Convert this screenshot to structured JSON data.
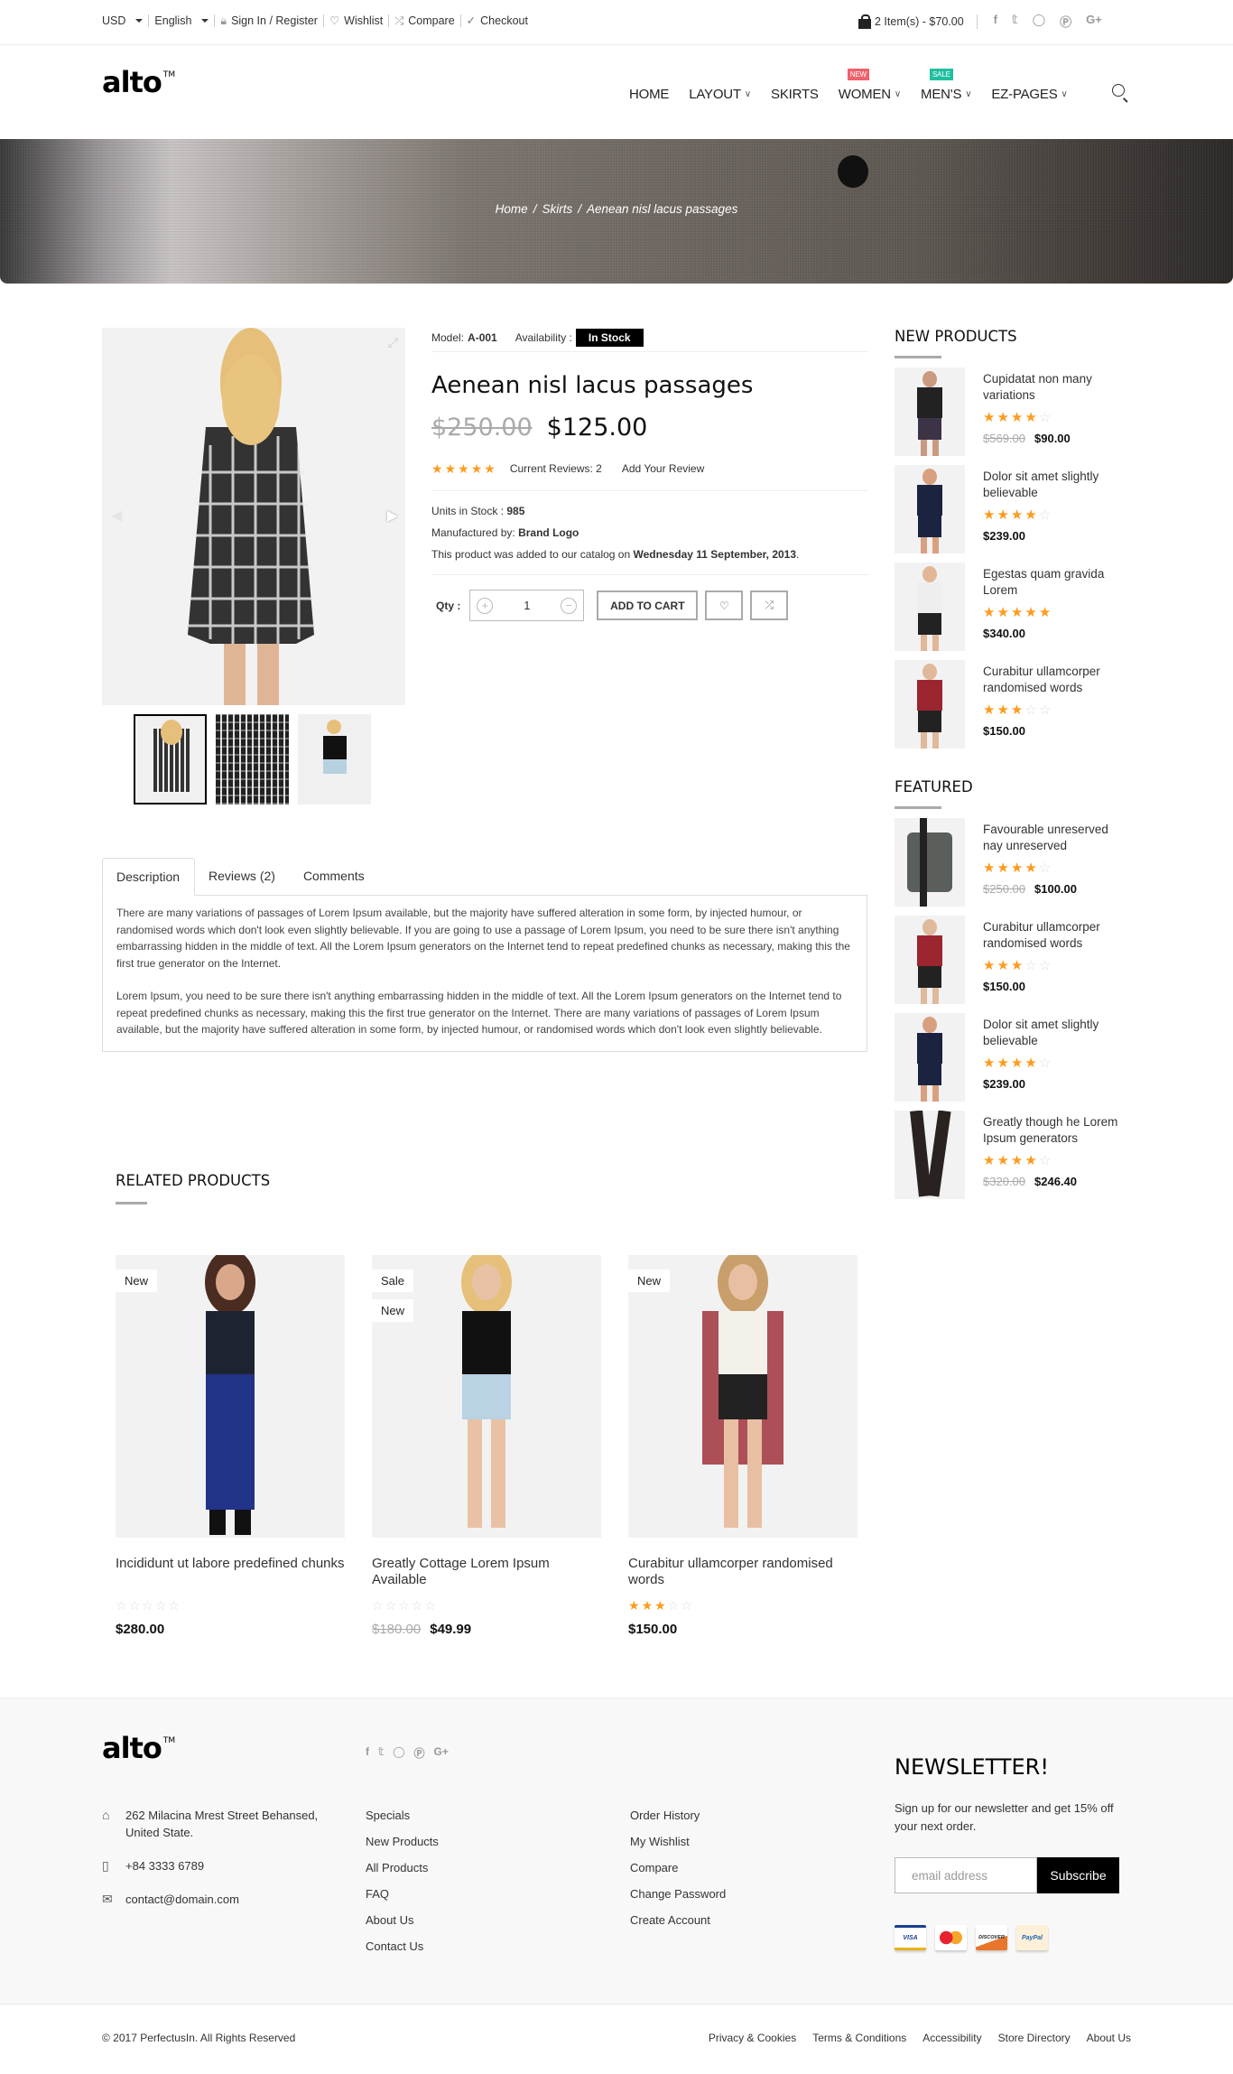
{
  "topbar": {
    "currency": "USD",
    "language": "English",
    "sign_in": "Sign In / Register",
    "wishlist": "Wishlist",
    "compare": "Compare",
    "checkout": "Checkout",
    "cart": "2 Item(s) - $70.00",
    "social": [
      "f",
      "t",
      "ig",
      "p",
      "G+"
    ]
  },
  "header": {
    "logo": "alto",
    "logo_tm": "TM",
    "nav": [
      {
        "label": "HOME",
        "dropdown": false
      },
      {
        "label": "LAYOUT",
        "dropdown": true
      },
      {
        "label": "SKIRTS",
        "dropdown": false
      },
      {
        "label": "WOMEN",
        "dropdown": true,
        "badge": "NEW"
      },
      {
        "label": "MEN'S",
        "dropdown": true,
        "badge": "SALE"
      },
      {
        "label": "EZ-PAGES",
        "dropdown": true
      }
    ]
  },
  "breadcrumb": [
    "Home",
    "Skirts",
    "Aenean nisl lacus passages"
  ],
  "product": {
    "model_label": "Model:",
    "model": "A-001",
    "availability_label": "Availability :",
    "availability": "In Stock",
    "title": "Aenean nisl lacus passages",
    "old_price": "$250.00",
    "price": "$125.00",
    "rating": 5,
    "reviews_text": "Current Reviews: 2",
    "add_review": "Add Your Review",
    "units_label": "Units in Stock :",
    "units": "985",
    "manufacturer_label": "Manufactured by:",
    "manufacturer": "Brand Logo",
    "added_prefix": "This product was added to our catalog on",
    "added_date": "Wednesday 11 September, 2013",
    "qty_label": "Qty :",
    "qty": "1",
    "add_to_cart": "ADD TO CART",
    "selected_thumb": 1,
    "thumb_count": 3
  },
  "tabs": {
    "items": [
      "Description",
      "Reviews (2)",
      "Comments"
    ],
    "active": 0,
    "paragraphs": [
      "There are many variations of passages of Lorem Ipsum available, but the majority have suffered alteration in some form, by injected humour, or randomised words which don't look even slightly believable. If you are going to use a passage of Lorem Ipsum, you need to be sure there isn't anything embarrassing hidden in the middle of text. All the Lorem Ipsum generators on the Internet tend to repeat predefined chunks as necessary, making this the first true generator on the Internet.",
      "Lorem Ipsum, you need to be sure there isn't anything embarrassing hidden in the middle of text. All the Lorem Ipsum generators on the Internet tend to repeat predefined chunks as necessary, making this the first true generator on the Internet. There are many variations of passages of Lorem Ipsum available, but the majority have suffered alteration in some form, by injected humour, or randomised words which don't look even slightly believable."
    ]
  },
  "related": {
    "title": "RELATED PRODUCTS",
    "items": [
      {
        "name": "Incididunt ut labore predefined chunks",
        "tags": [
          "New"
        ],
        "rating": 0,
        "old_price": "",
        "price": "$280.00"
      },
      {
        "name": "Greatly Cottage Lorem Ipsum Available",
        "tags": [
          "Sale",
          "New"
        ],
        "rating": 0,
        "old_price": "$180.00",
        "price": "$49.99"
      },
      {
        "name": "Curabitur ullamcorper randomised words",
        "tags": [
          "New"
        ],
        "rating": 3,
        "old_price": "",
        "price": "$150.00"
      }
    ]
  },
  "new_products": {
    "title": "NEW PRODUCTS",
    "items": [
      {
        "name": "Cupidatat non many variations",
        "rating": 4,
        "old_price": "$569.00",
        "price": "$90.00"
      },
      {
        "name": "Dolor sit amet slightly believable",
        "rating": 4,
        "old_price": "",
        "price": "$239.00"
      },
      {
        "name": "Egestas quam gravida Lorem",
        "rating": 5,
        "old_price": "",
        "price": "$340.00"
      },
      {
        "name": "Curabitur ullamcorper randomised words",
        "rating": 3,
        "old_price": "",
        "price": "$150.00"
      }
    ]
  },
  "featured": {
    "title": "FEATURED",
    "items": [
      {
        "name": "Favourable unreserved nay unreserved",
        "rating": 4,
        "old_price": "$250.00",
        "price": "$100.00"
      },
      {
        "name": "Curabitur ullamcorper randomised words",
        "rating": 3,
        "old_price": "",
        "price": "$150.00"
      },
      {
        "name": "Dolor sit amet slightly believable",
        "rating": 4,
        "old_price": "",
        "price": "$239.00"
      },
      {
        "name": "Greatly though he Lorem Ipsum generators",
        "rating": 4,
        "old_price": "$320.00",
        "price": "$246.40"
      }
    ]
  },
  "footer": {
    "address": "262 Milacina Mrest Street Behansed, United State.",
    "phone": "+84 3333 6789",
    "email": "contact@domain.com",
    "links1": [
      "Specials",
      "New Products",
      "All Products",
      "FAQ",
      "About Us",
      "Contact Us"
    ],
    "links2": [
      "Order History",
      "My Wishlist",
      "Compare",
      "Change Password",
      "Create Account"
    ],
    "newsletter_title": "NEWSLETTER!",
    "newsletter_text": "Sign up for our newsletter and get 15% off your next order.",
    "email_placeholder": "email address",
    "subscribe": "Subscribe",
    "payments": [
      "VISA",
      "MasterCard",
      "DISCOVER",
      "PayPal"
    ],
    "copyright": "© 2017 PerfectusIn. All Rights Reserved",
    "bottom_links": [
      "Privacy & Cookies",
      "Terms & Conditions",
      "Accessibility",
      "Store Directory",
      "About Us"
    ]
  },
  "colors": {
    "star": "#ff9a1c",
    "badge_new": "#f0606d",
    "badge_sale": "#1fbfa0",
    "accent": "#000000"
  }
}
